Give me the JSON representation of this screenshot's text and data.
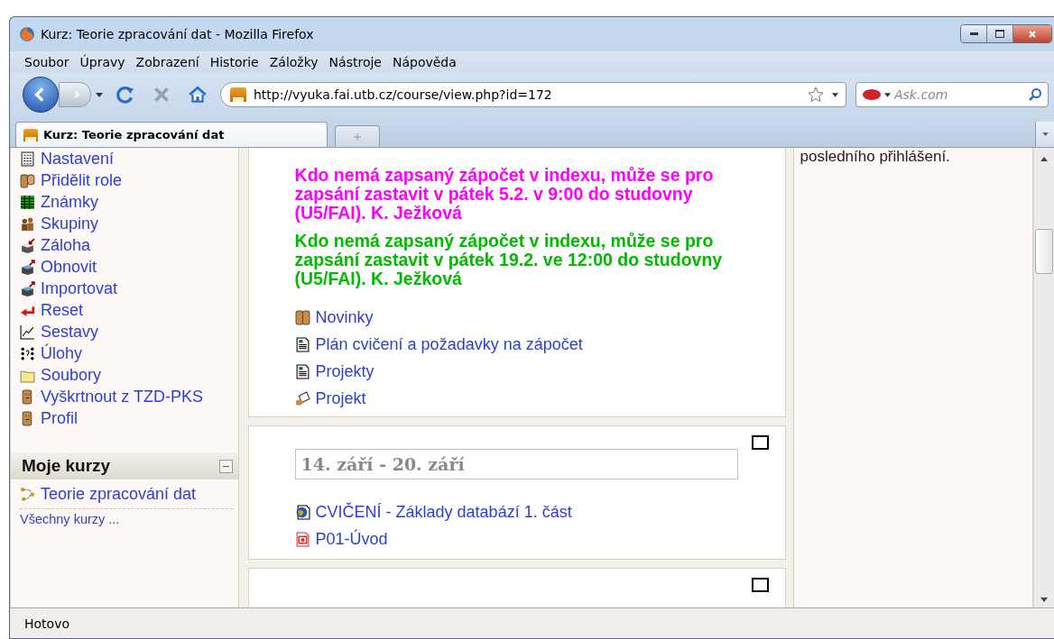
{
  "window": {
    "title": "Kurz: Teorie zpracování dat - Mozilla Firefox"
  },
  "menu": [
    "Soubor",
    "Úpravy",
    "Zobrazení",
    "Historie",
    "Záložky",
    "Nástroje",
    "Nápověda"
  ],
  "navigation": {
    "url": "http://vyuka.fai.utb.cz/course/view.php?id=172",
    "search": {
      "placeholder": "Ask.com"
    }
  },
  "tabs": [
    {
      "label": "Kurz: Teorie zpracování dat",
      "selected": true
    }
  ],
  "sidebar": {
    "items": [
      {
        "label": "Nastavení",
        "kind": "settings"
      },
      {
        "label": "Přidělit role",
        "kind": "roles"
      },
      {
        "label": "Známky",
        "kind": "grades"
      },
      {
        "label": "Skupiny",
        "kind": "groups"
      },
      {
        "label": "Záloha",
        "kind": "backup"
      },
      {
        "label": "Obnovit",
        "kind": "restore"
      },
      {
        "label": "Importovat",
        "kind": "restore"
      },
      {
        "label": "Reset",
        "kind": "reset"
      },
      {
        "label": "Sestavy",
        "kind": "reports"
      },
      {
        "label": "Úlohy",
        "kind": "questions"
      },
      {
        "label": "Soubory",
        "kind": "folder"
      },
      {
        "label": "Vyškrtnout z TZD-PKS",
        "kind": "person"
      },
      {
        "label": "Profil",
        "kind": "person"
      }
    ],
    "block": {
      "title": "Moje kurzy",
      "items": [
        {
          "label": "Teorie zpracování dat"
        }
      ],
      "footer_link": "Všechny kurzy ..."
    }
  },
  "main": {
    "notices": [
      {
        "text": "Kdo nemá zapsaný zápočet v indexu, může se pro zapsání zastavit v pátek 5.2. v 9:00 do studovny (U5/FAI). K. Ježková",
        "color": "#ff00ff"
      },
      {
        "text": "Kdo nemá zapsaný zápočet v indexu, může se pro zapsání zastavit v pátek 19.2. ve 12:00 do studovny (U5/FAI). K. Ježková",
        "color": "#00bb00"
      }
    ],
    "resources": [
      {
        "label": "Novinky",
        "kind": "forum"
      },
      {
        "label": "Plán cvičení a požadavky na zápočet",
        "kind": "page"
      },
      {
        "label": "Projekty",
        "kind": "page"
      },
      {
        "label": "Projekt",
        "kind": "assignment"
      }
    ],
    "sections": [
      {
        "title": "14. září - 20. září",
        "items": [
          {
            "label": "CVIČENÍ - Základy databází 1. část",
            "kind": "web"
          },
          {
            "label": "P01-Úvod",
            "kind": "powerpoint"
          }
        ]
      }
    ]
  },
  "right_column": {
    "text": "posledního přihlášení."
  },
  "status_bar": {
    "text": "Hotovo"
  }
}
